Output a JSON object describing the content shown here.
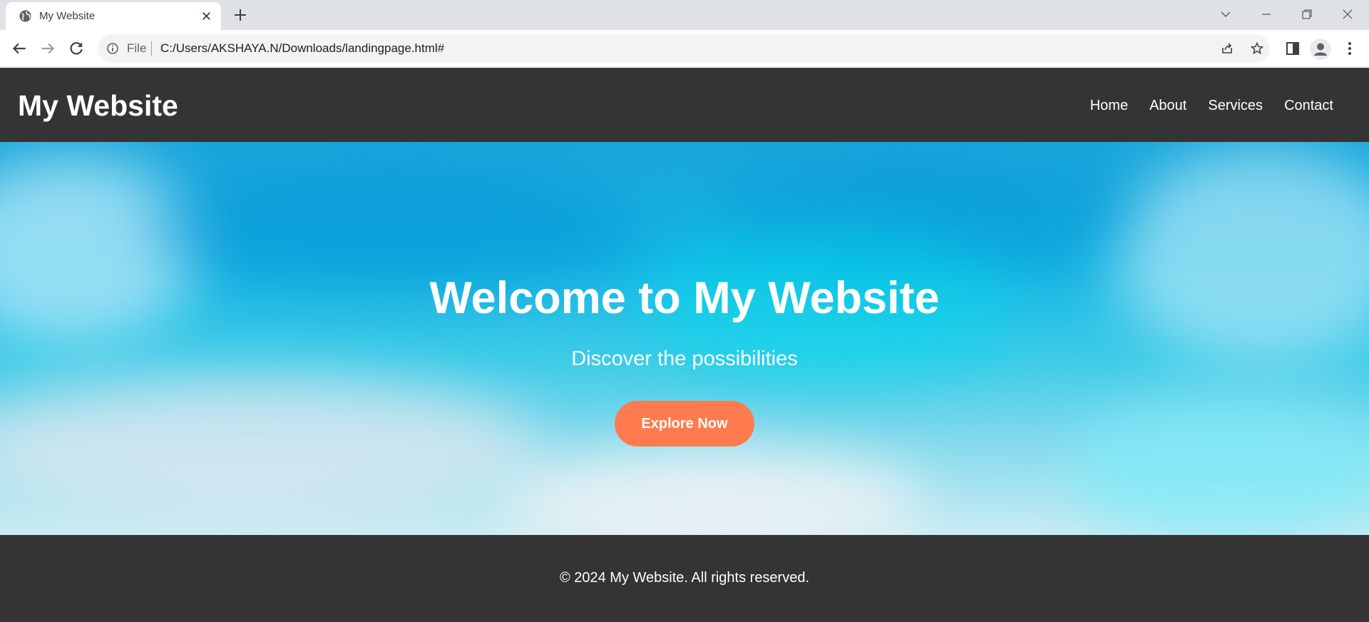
{
  "browser": {
    "tab_title": "My Website",
    "url_scheme": "File",
    "url": "C:/Users/AKSHAYA.N/Downloads/landingpage.html#",
    "icons": [
      "globe-icon",
      "close-icon",
      "plus-icon",
      "chevron-down-icon",
      "minimize-icon",
      "restore-icon",
      "window-close-icon",
      "back-icon",
      "forward-icon",
      "reload-icon",
      "info-icon",
      "share-icon",
      "star-icon",
      "side-panel-icon",
      "profile-icon",
      "menu-icon"
    ]
  },
  "site": {
    "logo": "My Website",
    "nav": [
      {
        "label": "Home"
      },
      {
        "label": "About"
      },
      {
        "label": "Services"
      },
      {
        "label": "Contact"
      }
    ],
    "hero": {
      "title": "Welcome to My Website",
      "subtitle": "Discover the possibilities",
      "cta_label": "Explore Now"
    },
    "footer": {
      "text": "© 2024 My Website. All rights reserved."
    }
  },
  "colors": {
    "header_bg": "#343434",
    "cta": "#ff7b4f",
    "sky": "#17b6e4"
  }
}
